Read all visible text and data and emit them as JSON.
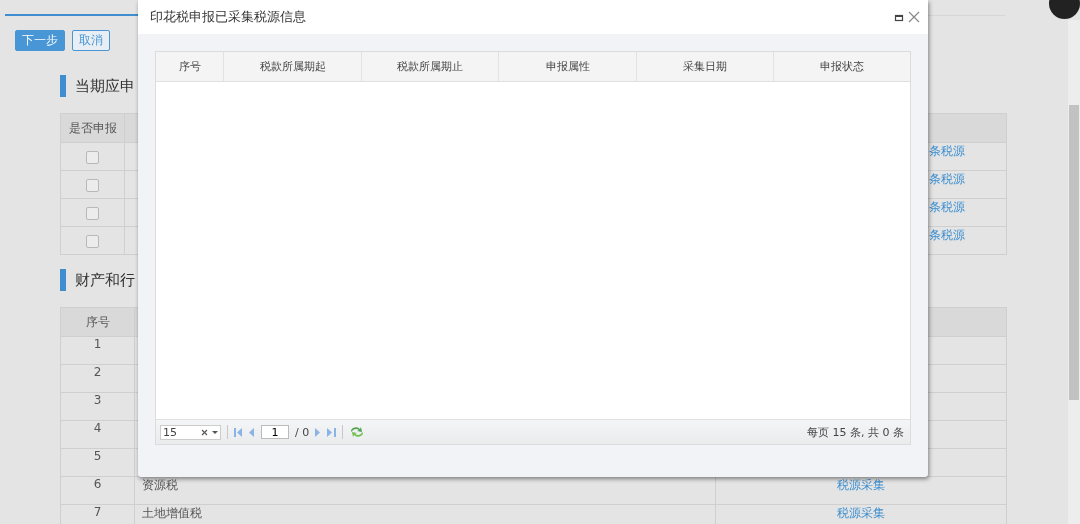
{
  "buttons": [
    {
      "label": "下一步",
      "kind": "primary"
    },
    {
      "label": "取消",
      "kind": "secondary"
    }
  ],
  "section_1": {
    "title": "当期应申",
    "columns": [
      "是否申报"
    ],
    "rows": [
      {
        "checked": false,
        "link": "条税源"
      },
      {
        "checked": false,
        "link": "条税源"
      },
      {
        "checked": false,
        "link": "条税源"
      },
      {
        "checked": false,
        "link": "条税源"
      }
    ]
  },
  "section_2": {
    "title": "财产和行",
    "columns": [
      "序号"
    ],
    "rows": [
      {
        "index": "1"
      },
      {
        "index": "2"
      },
      {
        "index": "3"
      },
      {
        "index": "4"
      },
      {
        "index": "5"
      },
      {
        "index": "6",
        "name": "资源税",
        "action": "税源采集"
      },
      {
        "index": "7",
        "name": "土地增值税",
        "action": "税源采集"
      }
    ]
  },
  "dialog": {
    "title": "印花税申报已采集税源信息",
    "columns": [
      "序号",
      "税款所属期起",
      "税款所属期止",
      "申报属性",
      "采集日期",
      "申报状态"
    ],
    "pager": {
      "page_size": "15",
      "page": "1",
      "total_pages": "/ 0",
      "summary": "每页 15 条, 共 0 条"
    }
  }
}
